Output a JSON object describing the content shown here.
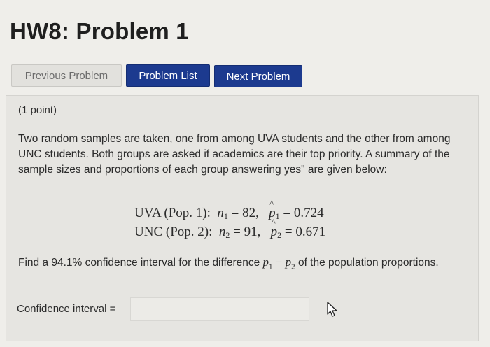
{
  "page": {
    "title": "HW8: Problem 1"
  },
  "nav": {
    "previous_label": "Previous Problem",
    "list_label": "Problem List",
    "next_label": "Next Problem"
  },
  "problem": {
    "points": "(1 point)",
    "description": "Two random samples are taken, one from among UVA students and the other from among UNC students. Both groups are asked if academics are their top priority. A summary of the sample sizes and proportions of each group answering yes\" are given below:",
    "rows": [
      {
        "label": "UVA (Pop. 1):",
        "n_sym": "n",
        "sub": "1",
        "n": "82",
        "p_sym": "p",
        "p": "0.724"
      },
      {
        "label": "UNC (Pop. 2):",
        "n_sym": "n",
        "sub": "2",
        "n": "91",
        "p_sym": "p",
        "p": "0.671"
      }
    ],
    "question_before": "Find a 94.1% confidence interval for the difference",
    "question_after": "of the population proportions.",
    "diff_p1": "p",
    "diff_sub1": "1",
    "diff_minus": "−",
    "diff_p2": "p",
    "diff_sub2": "2"
  },
  "answer": {
    "label": "Confidence interval =",
    "value": ""
  },
  "icons": {
    "cursor": "mouse-pointer-icon"
  }
}
